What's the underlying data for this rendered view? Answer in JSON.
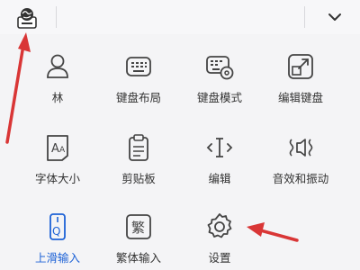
{
  "topbar": {
    "left_icon": "globe-keyboard-icon",
    "right_icon": "chevron-down-icon"
  },
  "menu": {
    "items": [
      {
        "label": "林",
        "icon": "user-icon"
      },
      {
        "label": "键盘布局",
        "icon": "keyboard-layout-icon"
      },
      {
        "label": "键盘模式",
        "icon": "keyboard-settings-icon"
      },
      {
        "label": "编辑键盘",
        "icon": "edit-keyboard-icon"
      },
      {
        "label": "字体大小",
        "icon": "font-size-icon"
      },
      {
        "label": "剪贴板",
        "icon": "clipboard-icon"
      },
      {
        "label": "编辑",
        "icon": "text-cursor-icon"
      },
      {
        "label": "音效和振动",
        "icon": "sound-vibration-icon"
      },
      {
        "label": "上滑输入",
        "icon": "swipe-input-icon",
        "active": true
      },
      {
        "label": "繁体输入",
        "icon": "traditional-chinese-icon"
      },
      {
        "label": "设置",
        "icon": "gear-icon"
      }
    ]
  },
  "colors": {
    "accent": "#1d62d6",
    "annotation_arrow": "#d93636",
    "icon_stroke": "#444444"
  }
}
